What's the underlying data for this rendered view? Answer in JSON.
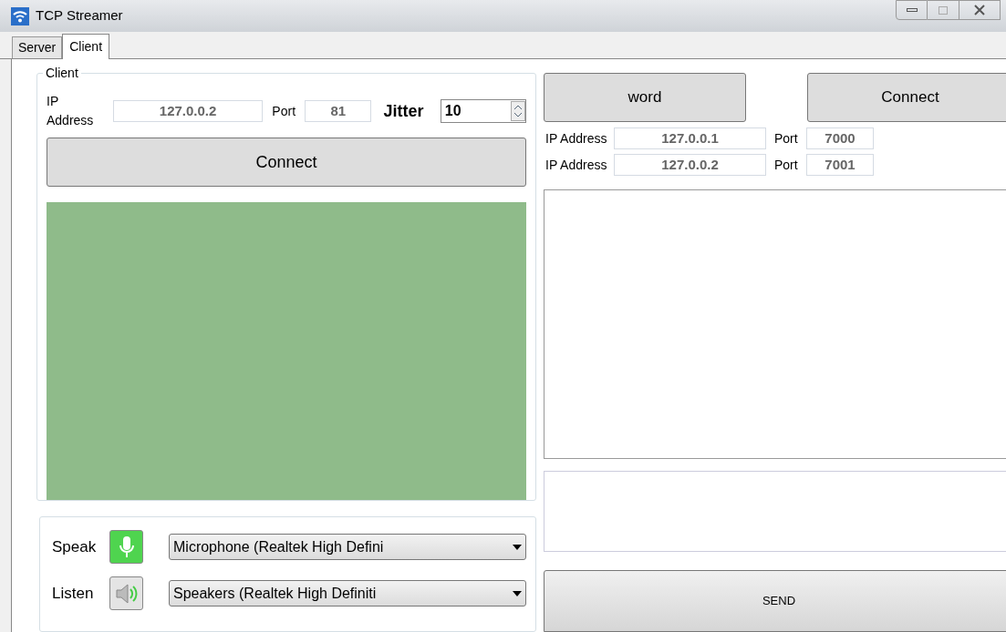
{
  "window": {
    "title": "TCP Streamer"
  },
  "tabs": [
    {
      "label": "Server",
      "selected": false
    },
    {
      "label": "Client",
      "selected": true
    }
  ],
  "client": {
    "group_title": "Client",
    "ip_label": "IP Address",
    "ip": "127.0.0.2",
    "port_label": "Port",
    "port": "81",
    "jitter_label": "Jitter",
    "jitter": "10",
    "connect": "Connect"
  },
  "audio": {
    "speak_label": "Speak",
    "microphone": "Microphone (Realtek High Defini",
    "listen_label": "Listen",
    "speakers": "Speakers (Realtek High Definiti"
  },
  "right": {
    "word_button": "word",
    "connect_button": "Connect",
    "endpoints": [
      {
        "ip_label": "IP Address",
        "ip": "127.0.0.1",
        "port_label": "Port",
        "port": "7000"
      },
      {
        "ip_label": "IP Address",
        "ip": "127.0.0.2",
        "port_label": "Port",
        "port": "7001"
      }
    ],
    "send": "SEND"
  }
}
